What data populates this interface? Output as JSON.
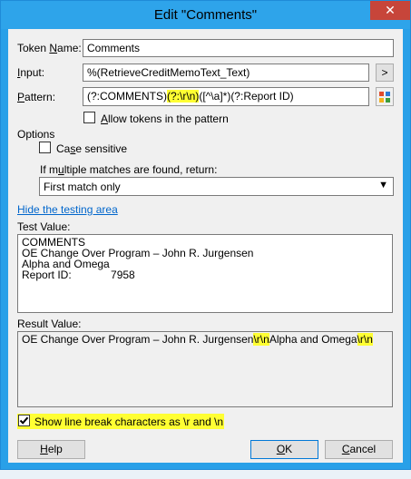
{
  "window": {
    "title": "Edit \"Comments\"",
    "close_glyph": "✕"
  },
  "token_name": {
    "label_prefix": "Token ",
    "label_key": "N",
    "label_rest": "ame:",
    "value": "Comments"
  },
  "input": {
    "label_key": "I",
    "label_rest": "nput:",
    "value": "%(RetrieveCreditMemoText_Text)",
    "button": ">"
  },
  "pattern": {
    "label_key": "P",
    "label_rest": "attern:",
    "value_a": "(?:COMMENTS)",
    "value_hl": "(?:\\r\\n)",
    "value_b": "([^\\a]*)(?:Report ID)"
  },
  "allow_tokens": {
    "label_key": "A",
    "label_rest": "llow tokens in the pattern",
    "checked": false
  },
  "options": {
    "heading": "Options",
    "case_sensitive": {
      "label_pre": "Ca",
      "label_key": "s",
      "label_rest": "e sensitive",
      "checked": false
    },
    "multiple_label_pre": "If m",
    "multiple_label_key": "u",
    "multiple_label_rest": "ltiple matches are found, return:",
    "multiple_selected": "First match only"
  },
  "hide_testing_link": "Hide the testing area",
  "test_value": {
    "label": "Test Value:",
    "lines": [
      "COMMENTS",
      "OE Change Over Program – John R. Jurgensen",
      "Alpha and Omega",
      "Report ID:             7958"
    ]
  },
  "result_value": {
    "label": "Result Value:",
    "part1": "OE Change Over Program – John R. Jurgensen",
    "br1": "\\r\\n",
    "part2": "Alpha and Omega",
    "br2": "\\r\\n"
  },
  "show_linebreak": {
    "label": "Show line break characters as \\r and \\n",
    "checked": true
  },
  "buttons": {
    "help": {
      "key": "H",
      "rest": "elp"
    },
    "ok": {
      "key": "O",
      "rest": "K"
    },
    "cancel": {
      "key": "C",
      "rest": "ancel"
    }
  },
  "highlight_color": "#ffff33",
  "accent_color": "#2ea4ea"
}
